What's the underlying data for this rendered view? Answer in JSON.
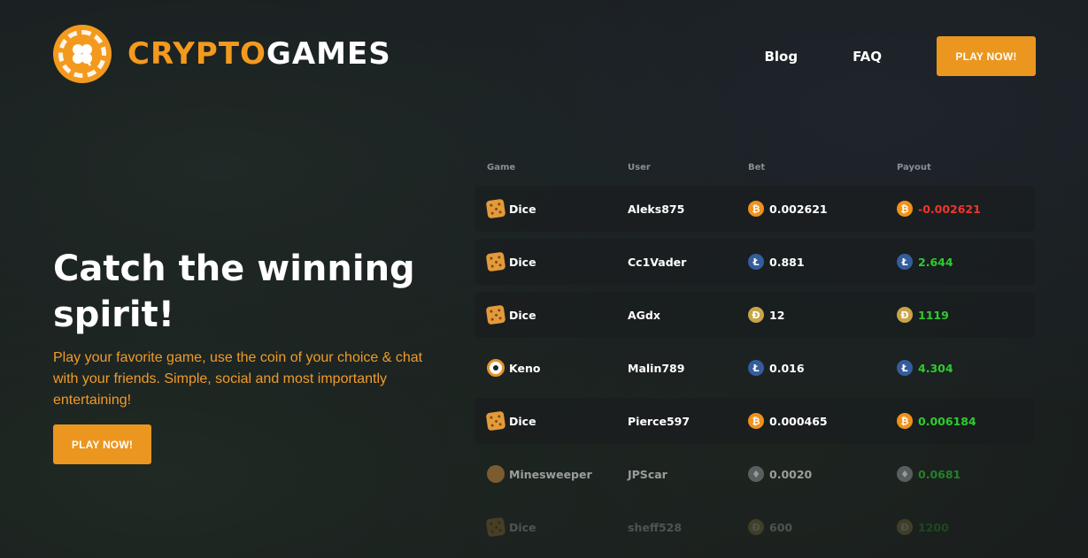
{
  "header": {
    "logo_part1": "CRYPTO",
    "logo_part2": "GAMES",
    "nav": {
      "blog": "Blog",
      "faq": "FAQ",
      "play": "PLAY NOW!"
    }
  },
  "hero": {
    "title": "Catch the winning spirit!",
    "description": "Play your favorite game, use the coin of your choice & chat with your friends. Simple, social and most importantly entertaining!",
    "button": "PLAY NOW!"
  },
  "colors": {
    "accent": "#eb961f",
    "positive": "#2ecc2e",
    "negative": "#f0362a"
  },
  "table": {
    "headers": [
      "Game",
      "User",
      "Bet",
      "Payout"
    ],
    "rows": [
      {
        "game": "Dice",
        "game_icon": "dice-icon",
        "user": "Aleks875",
        "coin": "bitcoin-icon",
        "bet": "0.002621",
        "payout": "-0.002621",
        "status": "loss"
      },
      {
        "game": "Dice",
        "game_icon": "dice-icon",
        "user": "Cc1Vader",
        "coin": "litecoin-icon",
        "bet": "0.881",
        "payout": "2.644",
        "status": "win"
      },
      {
        "game": "Dice",
        "game_icon": "dice-icon",
        "user": "AGdx",
        "coin": "dogecoin-icon",
        "bet": "12",
        "payout": "1119",
        "status": "win"
      },
      {
        "game": "Keno",
        "game_icon": "keno-icon",
        "user": "Malin789",
        "coin": "litecoin-icon",
        "bet": "0.016",
        "payout": "4.304",
        "status": "win"
      },
      {
        "game": "Dice",
        "game_icon": "dice-icon",
        "user": "Pierce597",
        "coin": "bitcoin-icon",
        "bet": "0.000465",
        "payout": "0.006184",
        "status": "win"
      },
      {
        "game": "Minesweeper",
        "game_icon": "mine-icon",
        "user": "JPScar",
        "coin": "ethereum-icon",
        "bet": "0.0020",
        "payout": "0.0681",
        "status": "win"
      },
      {
        "game": "Dice",
        "game_icon": "dice-icon",
        "user": "sheff528",
        "coin": "dogecoin-icon",
        "bet": "600",
        "payout": "1200",
        "status": "win"
      }
    ]
  }
}
